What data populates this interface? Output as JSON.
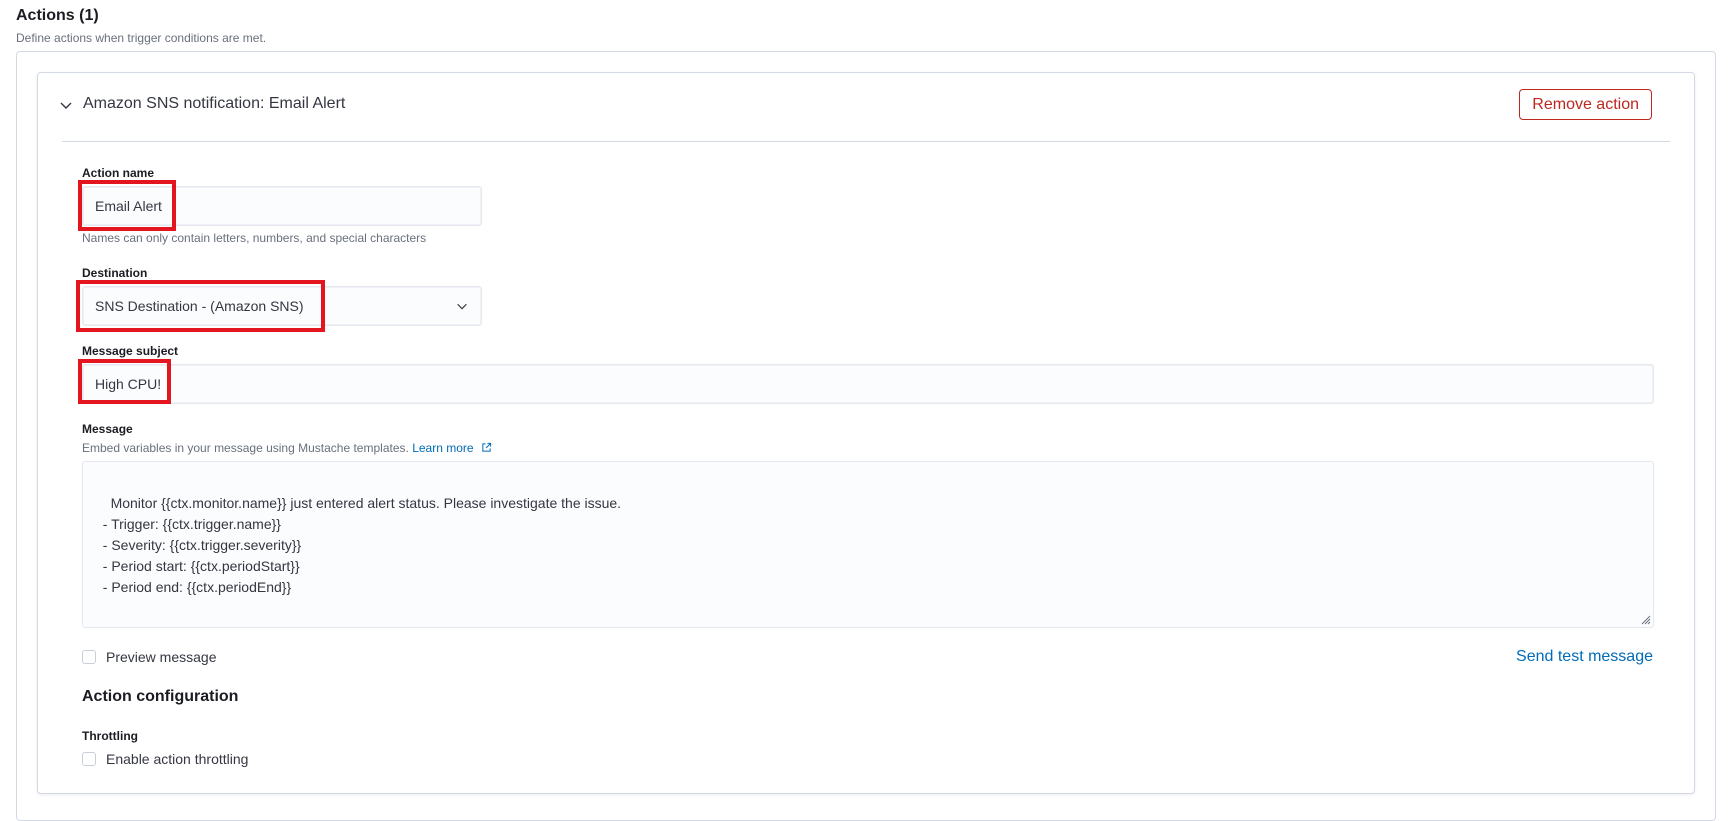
{
  "section": {
    "title": "Actions (1)",
    "description": "Define actions when trigger conditions are met."
  },
  "action": {
    "header_title": "Amazon SNS notification: Email Alert",
    "remove_label": "Remove action",
    "action_name": {
      "label": "Action name",
      "value": "Email Alert",
      "help": "Names can only contain letters, numbers, and special characters"
    },
    "destination": {
      "label": "Destination",
      "value": "SNS Destination - (Amazon SNS)"
    },
    "message_subject": {
      "label": "Message subject",
      "value": "High CPU!"
    },
    "message": {
      "label": "Message",
      "help": "Embed variables in your message using Mustache templates.",
      "learn_more": "Learn more",
      "value": "Monitor {{ctx.monitor.name}} just entered alert status. Please investigate the issue.\n  - Trigger: {{ctx.trigger.name}}\n  - Severity: {{ctx.trigger.severity}}\n  - Period start: {{ctx.periodStart}}\n  - Period end: {{ctx.periodEnd}}"
    },
    "preview_label": "Preview message",
    "send_test_label": "Send test message",
    "configuration": {
      "title": "Action configuration",
      "throttling_label": "Throttling",
      "enable_throttling_label": "Enable action throttling"
    }
  },
  "colors": {
    "highlight": "#e3161f",
    "danger": "#bd271e",
    "link": "#006bb8"
  },
  "icons": [
    "chevron-down-icon",
    "external-link-icon",
    "resize-handle-icon"
  ]
}
